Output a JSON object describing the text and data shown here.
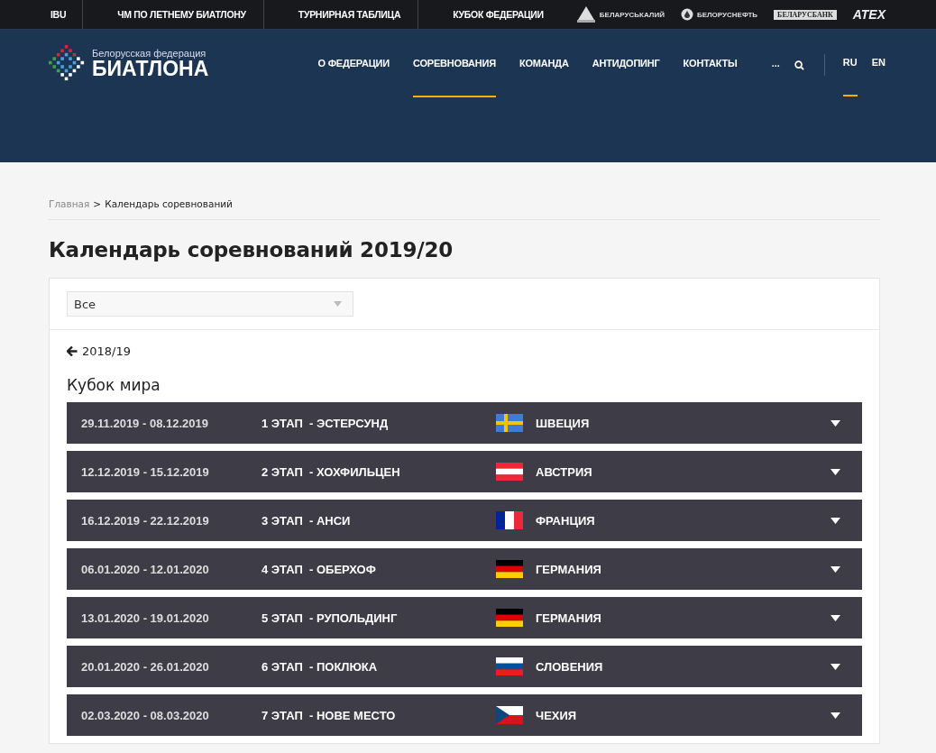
{
  "top_links": [
    "IBU",
    "ЧМ ПО ЛЕТНЕМУ БИАТЛОНУ",
    "ТУРНИРНАЯ ТАБЛИЦА",
    "КУБОК ФЕДЕРАЦИИ"
  ],
  "sponsors": [
    {
      "kind": "potash",
      "label": "БЕЛАРУСЬКАЛИЙ"
    },
    {
      "kind": "oil",
      "label": "БЕЛОРУСНЕФТЬ"
    },
    {
      "kind": "bank",
      "label": "БЕЛАРУСБАНК"
    },
    {
      "kind": "atex",
      "label": "ATEX"
    }
  ],
  "logo": {
    "subtitle": "Белорусская федерация",
    "title": "БИАТЛОНА"
  },
  "nav": [
    {
      "label": "О ФЕДЕРАЦИИ",
      "selected": false
    },
    {
      "label": "СОРЕВНОВАНИЯ",
      "selected": true
    },
    {
      "label": "КОМАНДА",
      "selected": false
    },
    {
      "label": "АНТИДОПИНГ",
      "selected": false
    },
    {
      "label": "КОНТАКТЫ",
      "selected": false
    }
  ],
  "more": "...",
  "languages": [
    {
      "label": "RU",
      "selected": true
    },
    {
      "label": "EN",
      "selected": false
    }
  ],
  "breadcrumb": {
    "home": "Главная",
    "separator": ">",
    "current": "Календарь соревнований"
  },
  "title": "Календарь соревнований 2019/20",
  "filter": {
    "value": "Все"
  },
  "back_link": "2018/19",
  "section": "Кубок мира",
  "events": [
    {
      "dates": "29.11.2019 - 08.12.2019",
      "stage": "1 ЭТАП  - ЭСТЕРСУНД",
      "kind": "se",
      "country": "ШВЕЦИЯ",
      "expanded": false
    },
    {
      "dates": "12.12.2019 - 15.12.2019",
      "stage": "2 ЭТАП  - ХОХФИЛЬЦЕН",
      "kind": "at",
      "country": "АВСТРИЯ",
      "expanded": false
    },
    {
      "dates": "16.12.2019 - 22.12.2019",
      "stage": "3 ЭТАП  - АНСИ",
      "kind": "fr",
      "country": "ФРАНЦИЯ",
      "expanded": false
    },
    {
      "dates": "06.01.2020 - 12.01.2020",
      "stage": "4 ЭТАП  - ОБЕРХОФ",
      "kind": "de",
      "country": "ГЕРМАНИЯ",
      "expanded": false
    },
    {
      "dates": "13.01.2020 - 19.01.2020",
      "stage": "5 ЭТАП  - РУПОЛЬДИНГ",
      "kind": "de",
      "country": "ГЕРМАНИЯ",
      "expanded": false
    },
    {
      "dates": "20.01.2020 - 26.01.2020",
      "stage": "6 ЭТАП  - ПОКЛЮКА",
      "kind": "si",
      "country": "СЛОВЕНИЯ",
      "expanded": false
    },
    {
      "dates": "02.03.2020 - 08.03.2020",
      "stage": "7 ЭТАП  - НОВЕ МЕСТО",
      "kind": "cz",
      "country": "ЧЕХИЯ",
      "expanded": false
    }
  ]
}
